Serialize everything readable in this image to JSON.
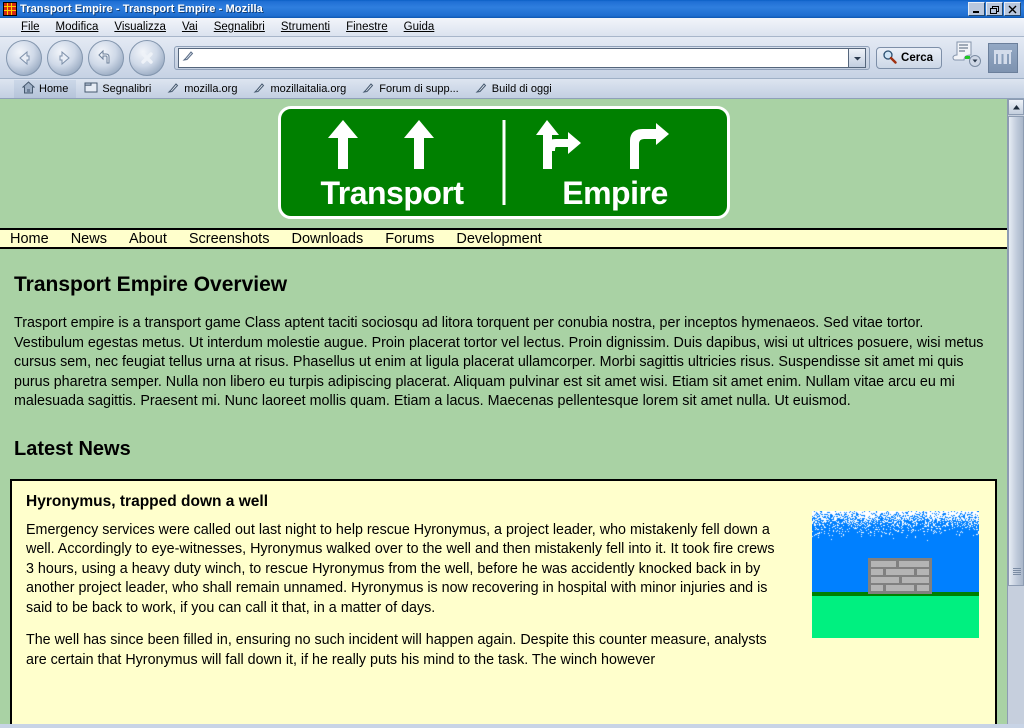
{
  "window": {
    "title": "Transport Empire - Transport Empire - Mozilla",
    "app_icon": "mozilla-app-icon",
    "controls": {
      "minimize": "_",
      "restore": "❐",
      "close": "✕"
    }
  },
  "menubar": {
    "items": [
      {
        "label": "File",
        "accel": "F"
      },
      {
        "label": "Modifica",
        "accel": "M"
      },
      {
        "label": "Visualizza",
        "accel": "V"
      },
      {
        "label": "Vai",
        "accel": "a"
      },
      {
        "label": "Segnalibri",
        "accel": "S"
      },
      {
        "label": "Strumenti",
        "accel": "S"
      },
      {
        "label": "Finestre",
        "accel": "n"
      },
      {
        "label": "Guida",
        "accel": "G"
      }
    ]
  },
  "toolbar": {
    "back_icon": "back-arrow-icon",
    "forward_icon": "forward-arrow-icon",
    "reload_icon": "reload-icon",
    "stop_icon": "stop-icon",
    "url_value": "",
    "url_placeholder": "",
    "url_page_icon": "page-icon",
    "dropdown_icon": "chevron-down-icon",
    "search_label": "Cerca",
    "search_icon": "magnifier-icon",
    "print_icon": "print-icon",
    "logo_icon": "mozilla-logo-icon"
  },
  "bookmarks": {
    "items": [
      {
        "label": "Home",
        "icon": "home-icon"
      },
      {
        "label": "Segnalibri",
        "icon": "folder-icon"
      },
      {
        "label": "mozilla.org",
        "icon": "bookmark-icon"
      },
      {
        "label": "mozillaitalia.org",
        "icon": "bookmark-icon"
      },
      {
        "label": "Forum di supp...",
        "icon": "bookmark-icon"
      },
      {
        "label": "Build di oggi",
        "icon": "bookmark-icon"
      }
    ]
  },
  "page": {
    "banner": {
      "left_text": "Transport",
      "right_text": "Empire",
      "sign_color": "#008000",
      "text_color": "#ffffff"
    },
    "sitenav": {
      "items": [
        "Home",
        "News",
        "About",
        "Screenshots",
        "Downloads",
        "Forums",
        "Development"
      ]
    },
    "overview": {
      "heading": "Transport Empire Overview",
      "paragraph": "Trasport empire is a transport game Class aptent taciti sociosqu ad litora torquent per conubia nostra, per inceptos hymenaeos. Sed vitae tortor. Vestibulum egestas metus. Ut interdum molestie augue. Proin placerat tortor vel lectus. Proin dignissim. Duis dapibus, wisi ut ultrices posuere, wisi metus cursus sem, nec feugiat tellus urna at risus. Phasellus ut enim at ligula placerat ullamcorper. Morbi sagittis ultricies risus. Suspendisse sit amet mi quis purus pharetra semper. Nulla non libero eu turpis adipiscing placerat. Aliquam pulvinar est sit amet wisi. Etiam sit amet enim. Nullam vitae arcu eu mi malesuada sagittis. Praesent mi. Nunc laoreet mollis quam. Etiam a lacus. Maecenas pellentesque lorem sit amet nulla. Ut euismod."
    },
    "news": {
      "heading": "Latest News",
      "article": {
        "title": "Hyronymus, trapped down a well",
        "paragraph1": "Emergency services were called out last night to help rescue Hyronymus, a project leader, who mistakenly fell down a well. Accordingly to eye-witnesses, Hyronymus walked over to the well and then mistakenly fell into it. It took fire crews 3 hours, using a heavy duty winch, to rescue Hyronymus from the well, before he was accidently knocked back in by another project leader, who shall remain unnamed. Hyronymus is now recovering in hospital with minor injuries and is said to be back to work, if you can call it that, in a matter of days.",
        "paragraph2": "The well has since been filled in, ensuring no such incident will happen again. Despite this counter measure, analysts are certain that Hyronymus will fall down it, if he really puts his mind to the task. The winch however",
        "image_alt": "pixel-art-well-illustration"
      }
    },
    "colors": {
      "page_background": "#a9d2a4",
      "nav_background": "#ffffcc",
      "box_background": "#ffffcc",
      "sky": "#0080ff",
      "grass": "#00f080",
      "horizon": "#008000",
      "well_frame": "#808080",
      "well_brick": "#b4b4b4"
    }
  },
  "scrollbar": {
    "up_icon": "scroll-up-icon"
  }
}
